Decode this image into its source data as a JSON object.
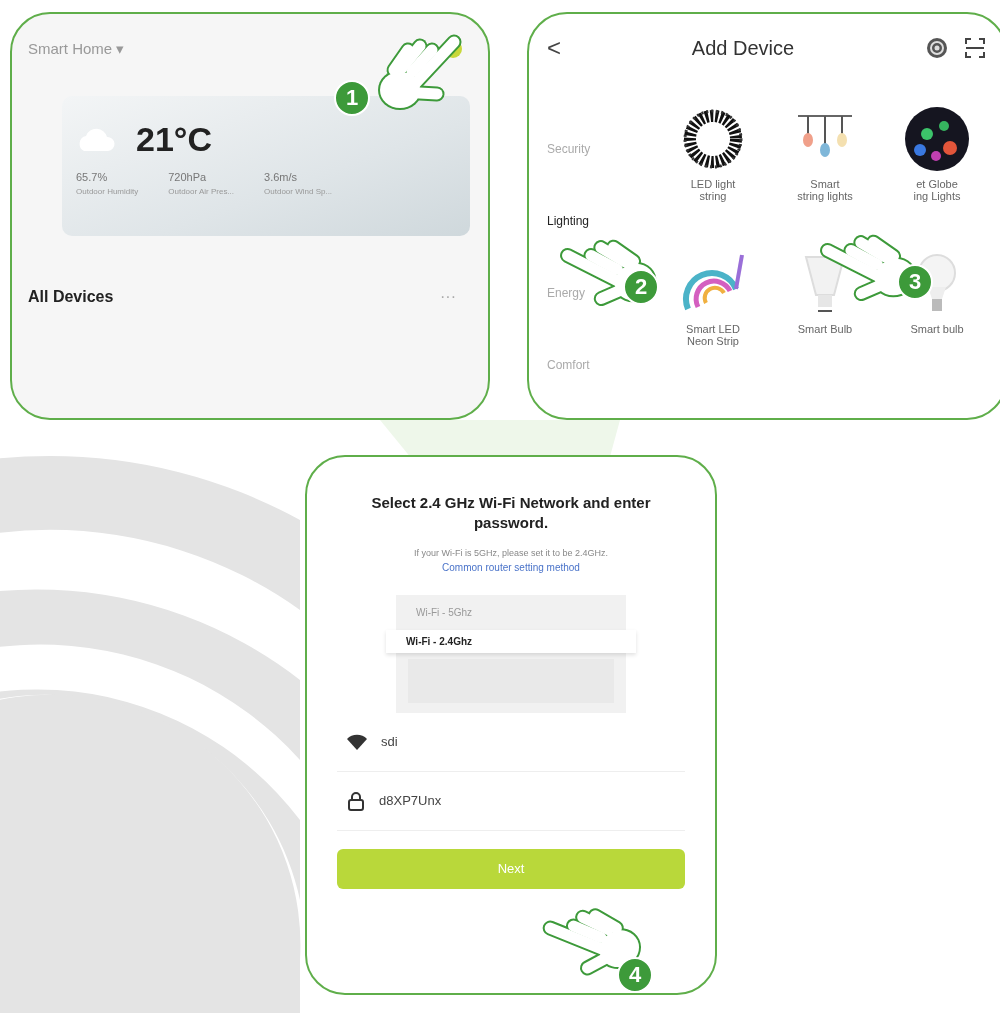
{
  "home": {
    "title": "Smart Home",
    "dropdown": "▾",
    "temperature": "21°C",
    "stats": [
      {
        "value": "65.7%",
        "label": "Outdoor Humidity"
      },
      {
        "value": "720hPa",
        "label": "Outdoor Air Pres..."
      },
      {
        "value": "3.6m/s",
        "label": "Outdoor Wind Sp..."
      }
    ],
    "section": "All Devices",
    "more": "···",
    "step": "1"
  },
  "add_device": {
    "back": "<",
    "title": "Add Device",
    "categories": [
      {
        "label": "Security",
        "selected": false
      },
      {
        "label": "Lighting",
        "selected": true
      },
      {
        "label": "Energy",
        "selected": false
      },
      {
        "label": "Comfort",
        "selected": false
      }
    ],
    "devices": [
      {
        "kind": "led-string",
        "label": "LED light\nstring"
      },
      {
        "kind": "string-bulbs",
        "label": "Smart\nstring lights"
      },
      {
        "kind": "globe",
        "label": "et Globe\ning Lights"
      },
      {
        "kind": "neon",
        "label": "Smart LED\nNeon Strip"
      },
      {
        "kind": "spot",
        "label": "Smart Bulb"
      },
      {
        "kind": "bulb",
        "label": "Smart bulb"
      }
    ],
    "steps": [
      "2",
      "3"
    ]
  },
  "wifi": {
    "title": "Select 2.4 GHz Wi-Fi Network and enter password.",
    "hint": "If your Wi-Fi is 5GHz, please set it to be 2.4GHz.",
    "link": "Common router setting method",
    "networks": [
      {
        "name": "Wi-Fi - 5Ghz",
        "selected": false
      },
      {
        "name": "Wi-Fi - 2.4Ghz",
        "selected": true
      }
    ],
    "fields": [
      {
        "kind": "wifi",
        "value": "sdi"
      },
      {
        "kind": "password",
        "value": "d8XP7Unx"
      }
    ],
    "button": "Next",
    "step": "4"
  }
}
